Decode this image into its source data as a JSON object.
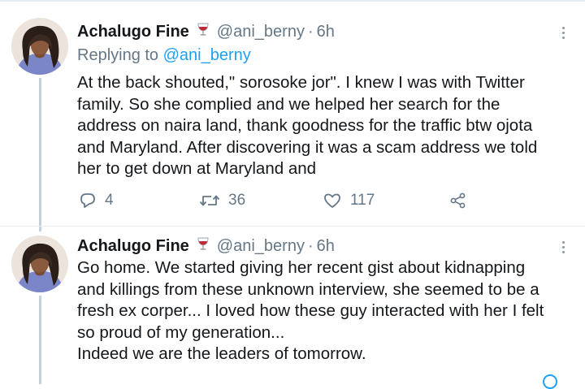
{
  "tweets": [
    {
      "author": "Achalugo Fine",
      "handle": "@ani_berny",
      "separator": "·",
      "time": "6h",
      "reply_prefix": "Replying to",
      "reply_handle": "@ani_berny",
      "text": [
        "At the back shouted,\" sorosoke jor\". I knew I was with Twitter",
        "family. So she complied and we helped her search for the",
        "address on naira land, thank goodness for the traffic btw ojota",
        "and Maryland. After discovering it was a scam address we told",
        "her to get down at Maryland and"
      ],
      "replies": "4",
      "retweets": "36",
      "likes": "117"
    },
    {
      "author": "Achalugo Fine",
      "handle": "@ani_berny",
      "separator": "·",
      "time": "6h",
      "text": [
        "Go home. We started giving her recent gist about kidnapping",
        "and killings from these unknown interview, she seemed to be a",
        "fresh ex corper... I loved how these guy interacted with her I felt",
        "so proud of my generation...",
        "Indeed we are the leaders of tomorrow."
      ]
    }
  ],
  "icons": {
    "emoji": "wine-glass-icon",
    "more": "more-vertical-icon",
    "reply": "reply-icon",
    "retweet": "retweet-icon",
    "like": "heart-icon",
    "share": "share-icon"
  },
  "colors": {
    "link": "#1da1f2",
    "muted": "#657786",
    "thread_line": "#c5d0d8"
  }
}
